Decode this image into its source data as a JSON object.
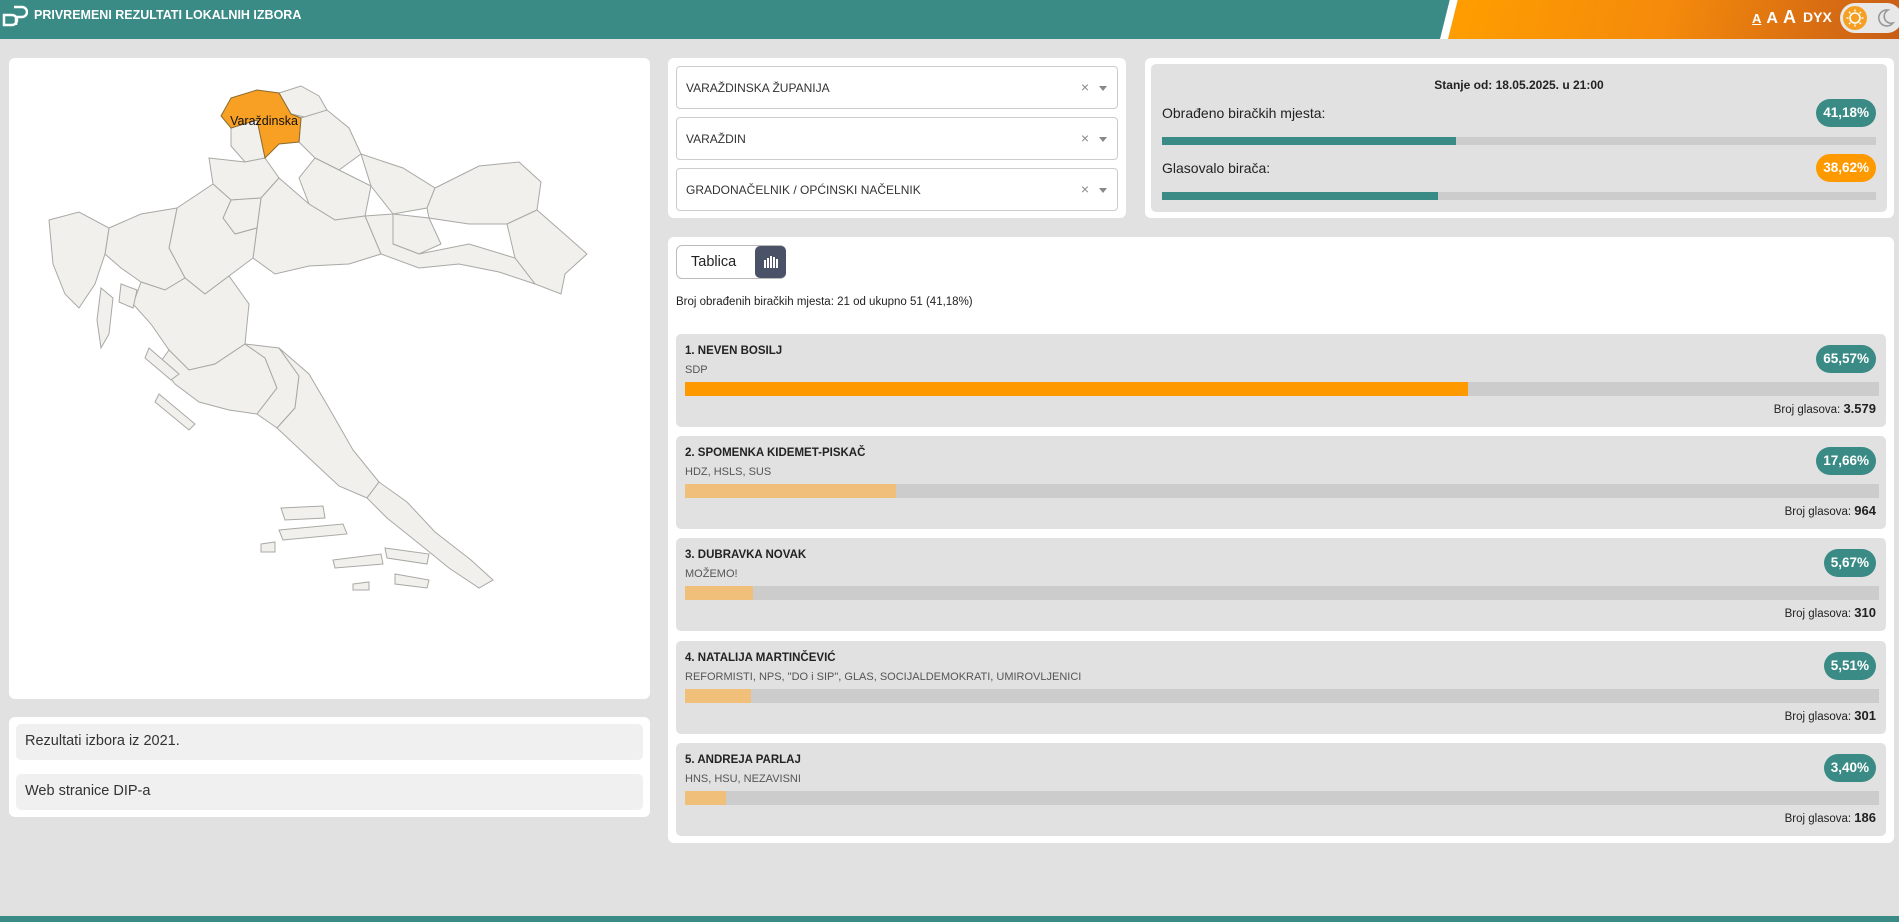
{
  "header": {
    "title": "PRIVREMENI REZULTATI LOKALNIH IZBORA",
    "font_small": "A",
    "font_medium": "A",
    "font_large": "A",
    "dyslexia_label": "DYX",
    "logo_icon": "dip-logo-icon",
    "theme_icons": [
      "sun-icon",
      "moon-icon"
    ]
  },
  "map": {
    "highlight_label": "Varaždinska",
    "highlight_color": "#f7a023"
  },
  "links": [
    {
      "label": "Rezultati izbora iz 2021."
    },
    {
      "label": "Web stranice DIP-a"
    }
  ],
  "filters": [
    {
      "value": "VARAŽDINSKA ŽUPANIJA",
      "clear": "×"
    },
    {
      "value": "VARAŽDIN",
      "clear": "×"
    },
    {
      "value": "GRADONAČELNIK / OPĆINSKI NAČELNIK",
      "clear": "×"
    }
  ],
  "stats": {
    "stanje": "Stanje od: 18.05.2025. u 21:00",
    "processed_label": "Obrađeno biračkih mjesta:",
    "processed_value": "41,18%",
    "processed_fraction": 0.4118,
    "turnout_label": "Glasovalo birača:",
    "turnout_value": "38,62%",
    "turnout_fraction": 0.3862
  },
  "results": {
    "view_table_label": "Tablica",
    "chart_icon": "bar-chart-icon",
    "summary": "Broj obrađenih biračkih mjesta: 21 od ukupno 51 (41,18%)",
    "votes_label": "Broj glasova:",
    "candidates": [
      {
        "name": "1. NEVEN BOSILJ",
        "party": "SDP",
        "percent": "65,57%",
        "fraction": 0.6557,
        "votes": "3.579"
      },
      {
        "name": "2. SPOMENKA KIDEMET-PISKAČ",
        "party": "HDZ, HSLS, SUS",
        "percent": "17,66%",
        "fraction": 0.1766,
        "votes": "964"
      },
      {
        "name": "3. DUBRAVKA NOVAK",
        "party": "MOŽEMO!",
        "percent": "5,67%",
        "fraction": 0.0567,
        "votes": "310"
      },
      {
        "name": "4. NATALIJA MARTINČEVIĆ",
        "party": "REFORMISTI, NPS, \"DO i SIP\", GLAS, SOCIJALDEMOKRATI, UMIROVLJENICI",
        "percent": "5,51%",
        "fraction": 0.0551,
        "votes": "301"
      },
      {
        "name": "5. ANDREJA PARLAJ",
        "party": "HNS, HSU, NEZAVISNI",
        "percent": "3,40%",
        "fraction": 0.034,
        "votes": "186"
      }
    ]
  },
  "colors": {
    "teal": "#3a8a85",
    "orange": "#ff9900",
    "leader_bar": "#ff9900",
    "other_bar": "#f0c07a",
    "progress_bar": "#3a8a85"
  }
}
